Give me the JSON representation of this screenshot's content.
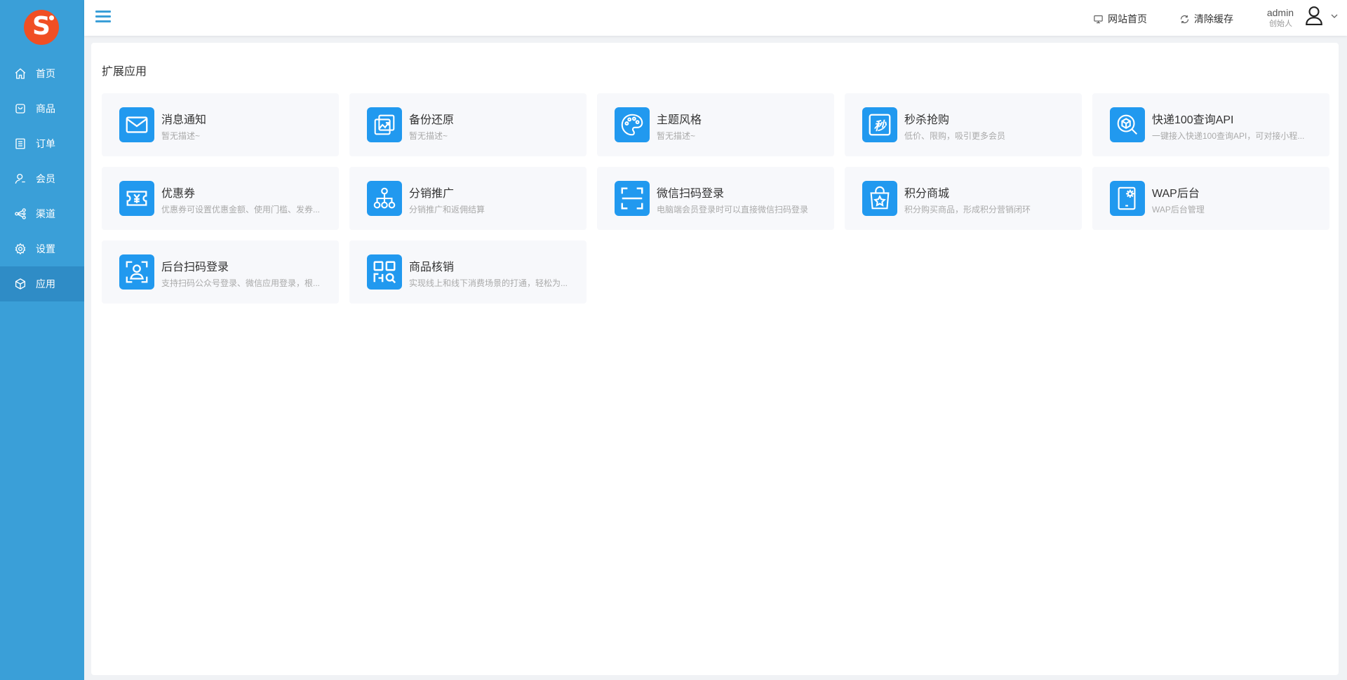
{
  "brand": {
    "logo_letter": "S",
    "logo_color": "#f04f24"
  },
  "sidebar": {
    "bg_color": "#3a9fd8",
    "items": [
      {
        "label": "首页",
        "icon": "home-icon"
      },
      {
        "label": "商品",
        "icon": "bag-icon"
      },
      {
        "label": "订单",
        "icon": "list-icon"
      },
      {
        "label": "会员",
        "icon": "user-icon"
      },
      {
        "label": "渠道",
        "icon": "share-icon"
      },
      {
        "label": "设置",
        "icon": "gear-icon"
      },
      {
        "label": "应用",
        "icon": "cube-icon",
        "active": true
      }
    ]
  },
  "header": {
    "website_home": "网站首页",
    "clear_cache": "清除缓存",
    "user": {
      "name": "admin",
      "role": "创始人"
    }
  },
  "main": {
    "title": "扩展应用",
    "accent_color": "#2199ef",
    "apps": [
      {
        "title": "消息通知",
        "desc": "暂无描述~",
        "icon": "mail-icon"
      },
      {
        "title": "备份还原",
        "desc": "暂无描述~",
        "icon": "backup-icon"
      },
      {
        "title": "主题风格",
        "desc": "暂无描述~",
        "icon": "palette-icon"
      },
      {
        "title": "秒杀抢购",
        "desc": "低价、限购，吸引更多会员",
        "icon": "flash-sale-icon"
      },
      {
        "title": "快递100查询API",
        "desc": "一键接入快递100查询API，可对接小程...",
        "icon": "package-search-icon"
      },
      {
        "title": "优惠券",
        "desc": "优惠券可设置优惠金额、使用门槛、发券...",
        "icon": "coupon-icon"
      },
      {
        "title": "分销推广",
        "desc": "分销推广和返佣结算",
        "icon": "org-chart-icon"
      },
      {
        "title": "微信扫码登录",
        "desc": "电脑端会员登录时可以直接微信扫码登录",
        "icon": "scan-icon"
      },
      {
        "title": "积分商城",
        "desc": "积分购买商品，形成积分营销闭环",
        "icon": "shopping-bag-star-icon"
      },
      {
        "title": "WAP后台",
        "desc": "WAP后台管理",
        "icon": "tablet-gear-icon"
      },
      {
        "title": "后台扫码登录",
        "desc": "支持扫码公众号登录、微信应用登录，根...",
        "icon": "scan-user-icon"
      },
      {
        "title": "商品核销",
        "desc": "实现线上和线下消费场景的打通，轻松为...",
        "icon": "qr-search-icon"
      }
    ]
  }
}
